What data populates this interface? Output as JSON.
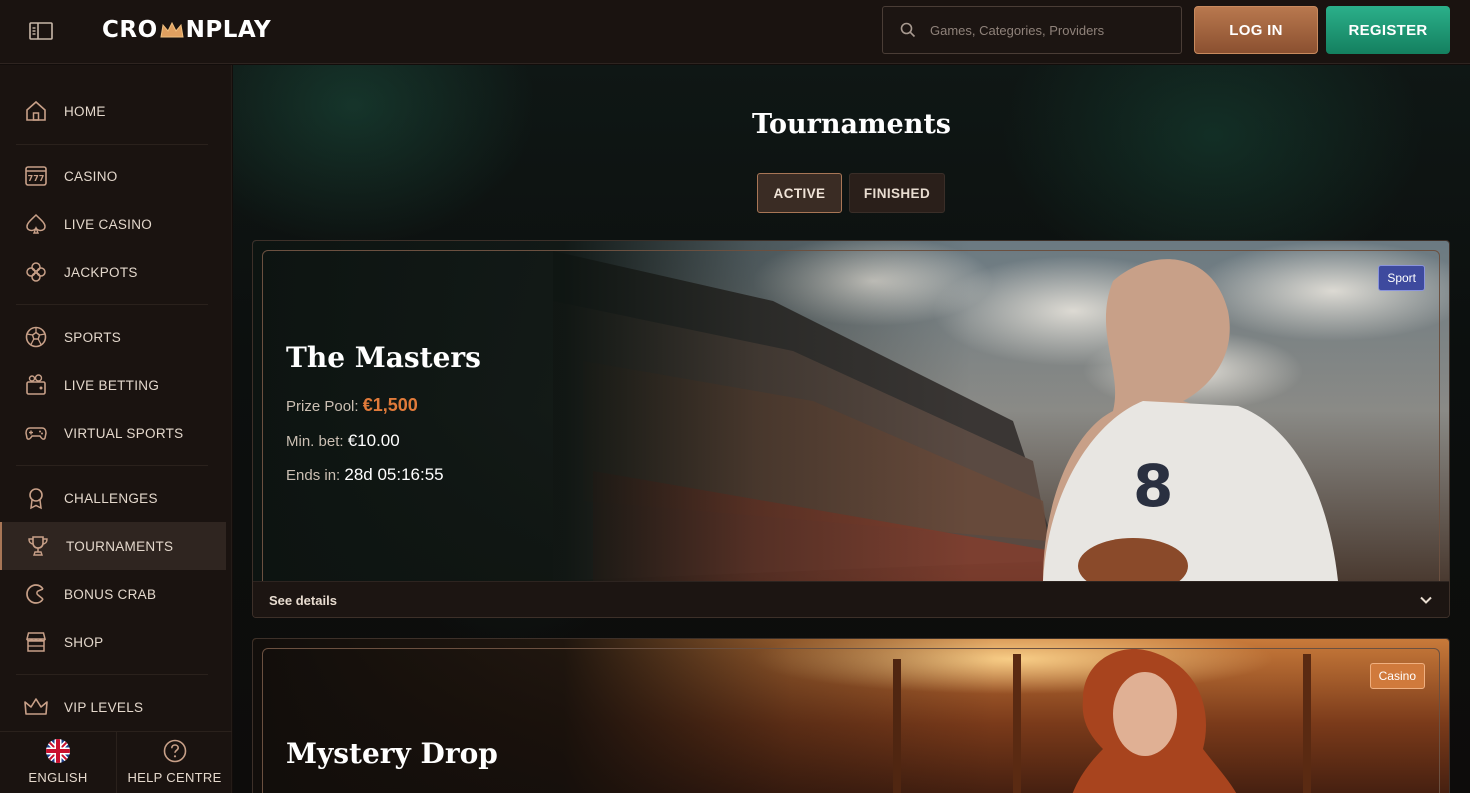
{
  "header": {
    "logo_text_left": "CRO",
    "logo_text_right": "NPLAY",
    "search_placeholder": "Games, Categories, Providers",
    "login_label": "LOG IN",
    "register_label": "REGISTER"
  },
  "sidebar": {
    "items": [
      {
        "label": "HOME",
        "icon": "home-icon"
      },
      {
        "label": "CASINO",
        "icon": "slot-machine-icon"
      },
      {
        "label": "LIVE CASINO",
        "icon": "spade-icon"
      },
      {
        "label": "JACKPOTS",
        "icon": "clover-icon"
      },
      {
        "label": "SPORTS",
        "icon": "soccer-ball-icon"
      },
      {
        "label": "LIVE BETTING",
        "icon": "tv-icon"
      },
      {
        "label": "VIRTUAL SPORTS",
        "icon": "gamepad-icon"
      },
      {
        "label": "CHALLENGES",
        "icon": "medal-icon"
      },
      {
        "label": "TOURNAMENTS",
        "icon": "trophy-icon",
        "active": true
      },
      {
        "label": "BONUS CRAB",
        "icon": "crab-claw-icon"
      },
      {
        "label": "SHOP",
        "icon": "shop-icon"
      },
      {
        "label": "VIP LEVELS",
        "icon": "crown-icon"
      }
    ],
    "footer": {
      "language_label": "ENGLISH",
      "help_label": "HELP CENTRE"
    }
  },
  "main": {
    "title": "Tournaments",
    "tabs": [
      {
        "label": "ACTIVE",
        "active": true
      },
      {
        "label": "FINISHED",
        "active": false
      }
    ],
    "tournaments": [
      {
        "title": "The Masters",
        "badge": "Sport",
        "prize_pool_label": "Prize Pool:",
        "prize_pool_value": "€1,500",
        "min_bet_label": "Min. bet:",
        "min_bet_value": "€10.00",
        "ends_in_label": "Ends in:",
        "ends_in_value": "28d 05:16:55",
        "details_label": "See details",
        "jersey_number": "8"
      },
      {
        "title": "Mystery Drop",
        "badge": "Casino"
      }
    ]
  },
  "colors": {
    "accent_copper": "#b8784e",
    "register_green": "#1f9a74",
    "prize_orange": "#e07a3a",
    "sport_badge": "#3e4a9e",
    "casino_badge": "#d07a3c"
  }
}
